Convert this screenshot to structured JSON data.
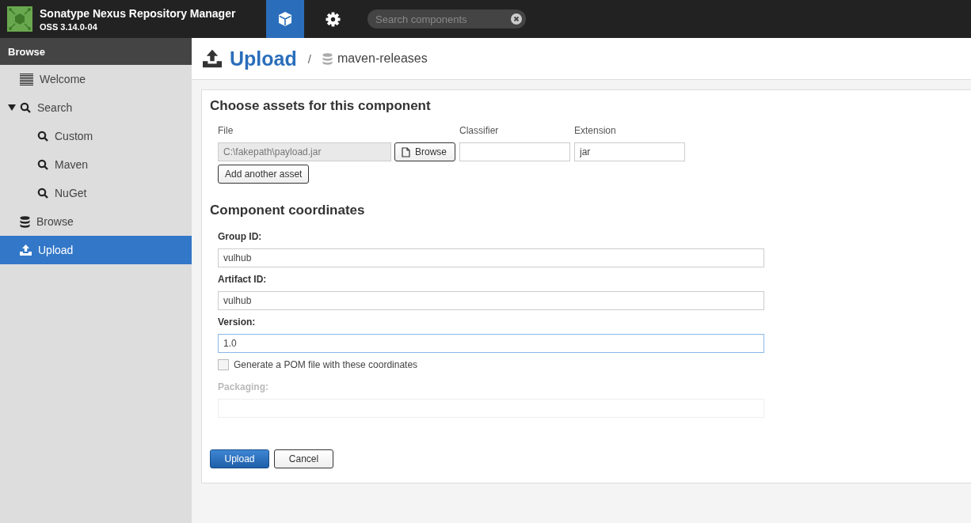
{
  "header": {
    "app_name": "Sonatype Nexus Repository Manager",
    "version": "OSS 3.14.0-04",
    "nav": [
      {
        "kind": "cube",
        "selected": true
      },
      {
        "kind": "gear",
        "selected": false
      }
    ],
    "search": {
      "placeholder": "Search components"
    }
  },
  "sidebar": {
    "title": "Browse",
    "items": [
      {
        "label": "Welcome",
        "kind": "lines",
        "selected": false
      },
      {
        "label": "Search",
        "kind": "search",
        "selected": false,
        "expanded": true,
        "children": [
          {
            "label": "Custom",
            "kind": "search",
            "selected": false
          },
          {
            "label": "Maven",
            "kind": "search",
            "selected": false
          },
          {
            "label": "NuGet",
            "kind": "search",
            "selected": false
          }
        ]
      },
      {
        "label": "Browse",
        "kind": "database",
        "selected": false
      },
      {
        "label": "Upload",
        "kind": "upload",
        "selected": true
      }
    ]
  },
  "page": {
    "title": "Upload",
    "separator": "/",
    "repository": "maven-releases"
  },
  "assets": {
    "heading": "Choose assets for this component",
    "columns": [
      "File",
      "Classifier",
      "Extension"
    ],
    "file": {
      "value": "C:\\fakepath\\payload.jar",
      "button": "Browse"
    },
    "extension": {
      "value": "jar"
    },
    "add_button": "Add another asset"
  },
  "coordinates": {
    "heading": "Component coordinates",
    "fields": [
      {
        "label": "Group ID:",
        "value": "vulhub",
        "focused": false
      },
      {
        "label": "Artifact ID:",
        "value": "vulhub",
        "focused": false
      },
      {
        "label": "Version:",
        "value": "1.0",
        "focused": true
      }
    ],
    "checkbox": {
      "label": "Generate a POM file with these coordinates",
      "checked": false
    },
    "packaging": {
      "label": "Packaging:",
      "disabled": true
    }
  },
  "buttons": [
    {
      "label": "Upload",
      "kind": "primary"
    },
    {
      "label": "Cancel",
      "kind": "default"
    }
  ]
}
